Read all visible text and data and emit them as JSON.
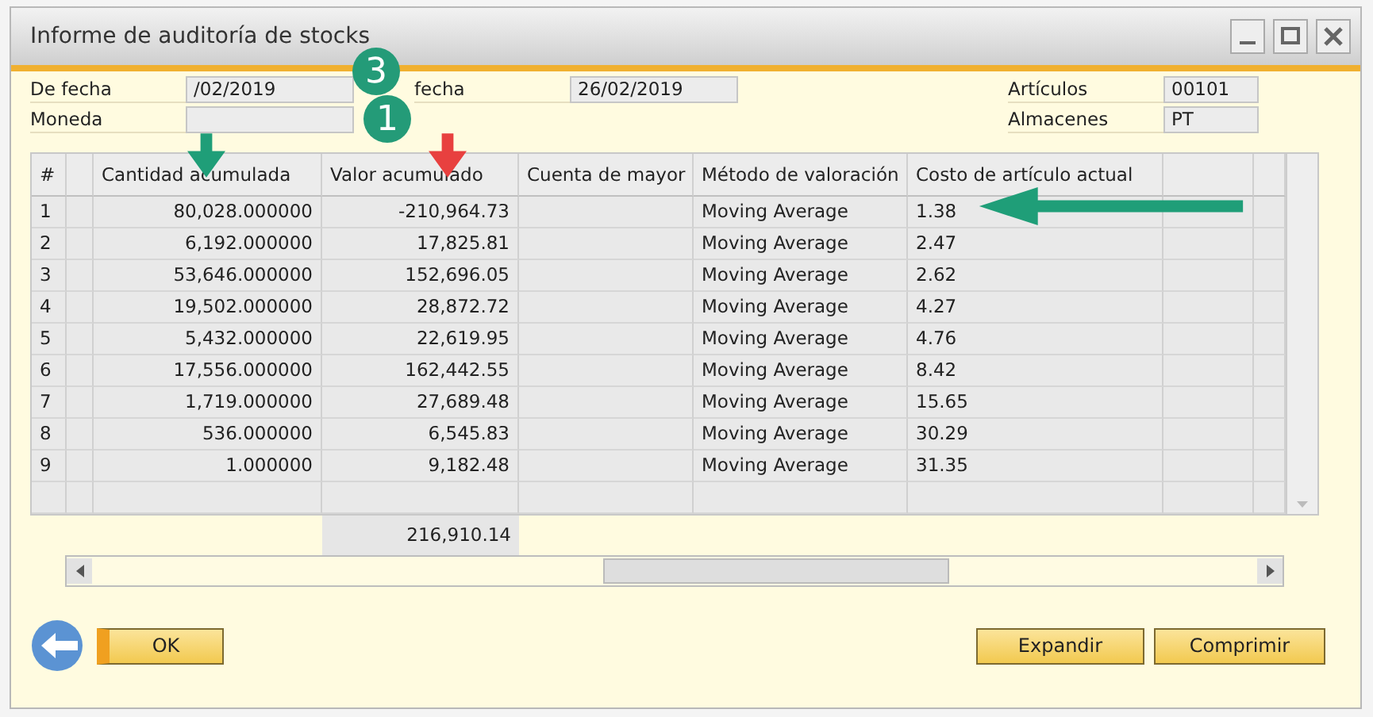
{
  "window": {
    "title": "Informe de auditoría de stocks"
  },
  "filters": {
    "left": [
      {
        "label": "De fecha",
        "value": "/02/2019"
      },
      {
        "label": "Moneda"
      }
    ],
    "middle": [
      {
        "label": "fecha",
        "value": "26/02/2019"
      }
    ],
    "right": [
      {
        "label": "Artículos",
        "value": "00101"
      },
      {
        "label": "Almacenes",
        "value": "PT"
      }
    ]
  },
  "table": {
    "columns": [
      {
        "label": "#"
      },
      {},
      {
        "label": "Cantidad acumulada"
      },
      {
        "label": "Valor acumulado"
      },
      {
        "label": "Cuenta de mayor"
      },
      {
        "label": "Método de valoración"
      },
      {
        "label": "Costo de artículo actual"
      },
      {},
      {}
    ],
    "rows": [
      {
        "number": "1",
        "quantity": "80,028.000000",
        "value": "-210,964.73",
        "method": "Moving Average",
        "cost": "1.38"
      },
      {
        "number": "2",
        "quantity": "6,192.000000",
        "value": "17,825.81",
        "method": "Moving Average",
        "cost": "2.47"
      },
      {
        "number": "3",
        "quantity": "53,646.000000",
        "value": "152,696.05",
        "method": "Moving Average",
        "cost": "2.62"
      },
      {
        "number": "4",
        "quantity": "19,502.000000",
        "value": "28,872.72",
        "method": "Moving Average",
        "cost": "4.27"
      },
      {
        "number": "5",
        "quantity": "5,432.000000",
        "value": "22,619.95",
        "method": "Moving Average",
        "cost": "4.76"
      },
      {
        "number": "6",
        "quantity": "17,556.000000",
        "value": "162,442.55",
        "method": "Moving Average",
        "cost": "8.42"
      },
      {
        "number": "7",
        "quantity": "1,719.000000",
        "value": "27,689.48",
        "method": "Moving Average",
        "cost": "15.65"
      },
      {
        "number": "8",
        "quantity": "536.000000",
        "value": "6,545.83",
        "method": "Moving Average",
        "cost": "30.29"
      },
      {
        "number": "9",
        "quantity": "1.000000",
        "value": "9,182.48",
        "method": "Moving Average",
        "cost": "31.35"
      }
    ],
    "totals": {
      "value": "216,910.14"
    }
  },
  "buttons": [
    {
      "label": "OK",
      "default": true
    },
    {
      "label": "Expandir",
      "default": false
    },
    {
      "label": "Comprimir",
      "default": false
    }
  ],
  "annotations": {
    "badges": [
      {
        "text": "1",
        "color": "#249b78"
      },
      {
        "text": "3",
        "color": "#249b78"
      }
    ],
    "arrows": [
      {
        "kind": "down",
        "color": "#1f9e78"
      },
      {
        "kind": "down",
        "color": "#e8403f"
      },
      {
        "kind": "left",
        "color": "#1f9e78"
      }
    ]
  }
}
